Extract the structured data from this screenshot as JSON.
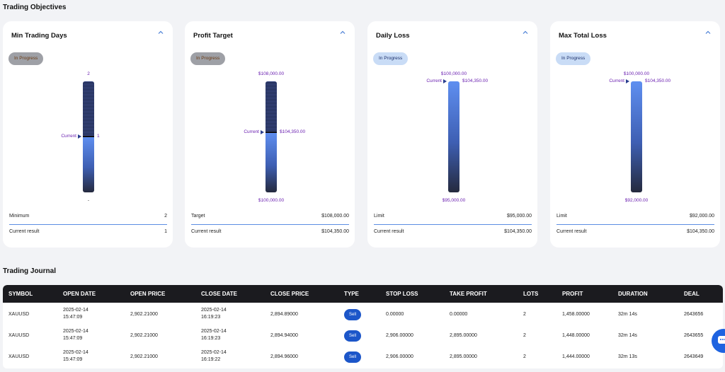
{
  "sections": {
    "objectives_title": "Trading Objectives",
    "journal_title": "Trading Journal"
  },
  "colors": {
    "accent": "#1c56c9",
    "bar_fill": "#5f8ff0",
    "label_purple": "#6a1fb0",
    "header_dark": "#1b1b1f"
  },
  "objectives": [
    {
      "title": "Min Trading Days",
      "status": "In Progress",
      "top_label": "2",
      "bottom_label": "-",
      "current_label": "Current",
      "current_value": "1",
      "current_fraction": 0.5,
      "row1_label": "Minimum",
      "row1_value": "2",
      "row2_label": "Current result",
      "row2_value": "1"
    },
    {
      "title": "Profit Target",
      "status": "In Progress",
      "top_label": "$108,000.00",
      "bottom_label": "$100,000.00",
      "current_label": "Current",
      "current_value": "$104,350.00",
      "current_fraction": 0.544,
      "row1_label": "Target",
      "row1_value": "$108,000.00",
      "row2_label": "Current result",
      "row2_value": "$104,350.00"
    },
    {
      "title": "Daily Loss",
      "status": "In Progress",
      "top_label": "$100,000.00",
      "bottom_label": "$95,000.00",
      "current_label": "Current",
      "current_value": "$104,350.00",
      "current_fraction": 1.0,
      "row1_label": "Limit",
      "row1_value": "$95,000.00",
      "row2_label": "Current result",
      "row2_value": "$104,350.00"
    },
    {
      "title": "Max Total Loss",
      "status": "In Progress",
      "top_label": "$100,000.00",
      "bottom_label": "$92,000.00",
      "current_label": "Current",
      "current_value": "$104,350.00",
      "current_fraction": 1.0,
      "row1_label": "Limit",
      "row1_value": "$92,000.00",
      "row2_label": "Current result",
      "row2_value": "$104,350.00"
    }
  ],
  "journal": {
    "headers": [
      "SYMBOL",
      "OPEN DATE",
      "OPEN PRICE",
      "CLOSE DATE",
      "CLOSE PRICE",
      "TYPE",
      "STOP LOSS",
      "TAKE PROFIT",
      "LOTS",
      "PROFIT",
      "DURATION",
      "DEAL"
    ],
    "rows": [
      {
        "symbol": "XAUUSD",
        "open_date": "2025-02-14",
        "open_time": "15:47:09",
        "open_price": "2,902.21000",
        "close_date": "2025-02-14",
        "close_time": "16:19:23",
        "close_price": "2,894.89000",
        "type": "Sell",
        "stop_loss": "0.00000",
        "take_profit": "0.00000",
        "lots": "2",
        "profit": "1,458.00000",
        "duration": "32m 14s",
        "deal": "2643656"
      },
      {
        "symbol": "XAUUSD",
        "open_date": "2025-02-14",
        "open_time": "15:47:09",
        "open_price": "2,902.21000",
        "close_date": "2025-02-14",
        "close_time": "16:19:23",
        "close_price": "2,894.94000",
        "type": "Sell",
        "stop_loss": "2,906.00000",
        "take_profit": "2,895.00000",
        "lots": "2",
        "profit": "1,448.00000",
        "duration": "32m 14s",
        "deal": "2643655"
      },
      {
        "symbol": "XAUUSD",
        "open_date": "2025-02-14",
        "open_time": "15:47:09",
        "open_price": "2,902.21000",
        "close_date": "2025-02-14",
        "close_time": "16:19:22",
        "close_price": "2,894.96000",
        "type": "Sell",
        "stop_loss": "2,906.00000",
        "take_profit": "2,895.00000",
        "lots": "2",
        "profit": "1,444.00000",
        "duration": "32m 13s",
        "deal": "2643649"
      }
    ]
  },
  "icons": {
    "chevron": "chevron-up-icon",
    "chat": "chat-icon"
  }
}
